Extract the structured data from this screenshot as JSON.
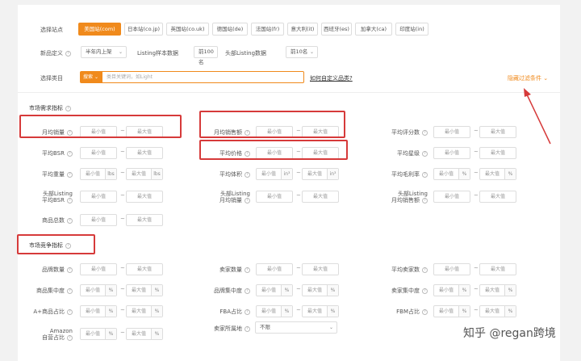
{
  "site": {
    "label": "选择站点",
    "tabs": [
      "美国站(com)",
      "日本站(co.jp)",
      "英国站(co.uk)",
      "德国站(de)",
      "法国站(fr)",
      "意大利(it)",
      "西班牙(es)",
      "加拿大(ca)",
      "印度站(in)"
    ],
    "active_index": 0
  },
  "period": {
    "label": "新品定义",
    "value": "半年内上架"
  },
  "sample": {
    "label": "Listing样本数据",
    "value": "前100名"
  },
  "top": {
    "label": "头部Listing数据",
    "value": "前10名"
  },
  "category": {
    "label": "选择类目",
    "search_btn": "搜索",
    "placeholder": "类目关键词，如Light",
    "help_link": "如何自定义品类?",
    "hide_filters": "隐藏过滤条件"
  },
  "placeholders": {
    "min": "最小值",
    "max": "最大值",
    "dash": "~"
  },
  "demand": {
    "title": "市场需求指标",
    "fields": [
      {
        "label": "月均销量",
        "unit": ""
      },
      {
        "label": "月均销售额",
        "unit": ""
      },
      {
        "label": "平均评分数",
        "unit": ""
      },
      {
        "label": "平均BSR",
        "unit": ""
      },
      {
        "label": "平均价格",
        "unit": ""
      },
      {
        "label": "平均星级",
        "unit": ""
      },
      {
        "label": "平均重量",
        "unit": "lbs"
      },
      {
        "label": "平均体积",
        "unit": "in³"
      },
      {
        "label": "平均毛利率",
        "unit": "%"
      },
      {
        "label": "头部Listing 平均BSR",
        "unit": ""
      },
      {
        "label": "头部Listing 月均销量",
        "unit": ""
      },
      {
        "label": "头部Listing 月均销售额",
        "unit": ""
      },
      {
        "label": "商品总数",
        "unit": ""
      }
    ]
  },
  "competition": {
    "title": "市场竞争指标",
    "fields": [
      {
        "label": "品牌数量",
        "unit": ""
      },
      {
        "label": "卖家数量",
        "unit": ""
      },
      {
        "label": "平均卖家数",
        "unit": ""
      },
      {
        "label": "商品集中度",
        "unit": "%"
      },
      {
        "label": "品牌集中度",
        "unit": "%"
      },
      {
        "label": "卖家集中度",
        "unit": "%"
      },
      {
        "label": "A+商品占比",
        "unit": "%"
      },
      {
        "label": "FBA占比",
        "unit": "%"
      },
      {
        "label": "FBM占比",
        "unit": "%"
      },
      {
        "label": "Amazon 自营占比",
        "unit": "%"
      }
    ],
    "seller_origin": {
      "label": "卖家所属地",
      "value": "不限"
    }
  },
  "watermark": "知乎 @regan跨境",
  "colors": {
    "accent": "#f08a1c",
    "annotation": "#d63a3a"
  }
}
